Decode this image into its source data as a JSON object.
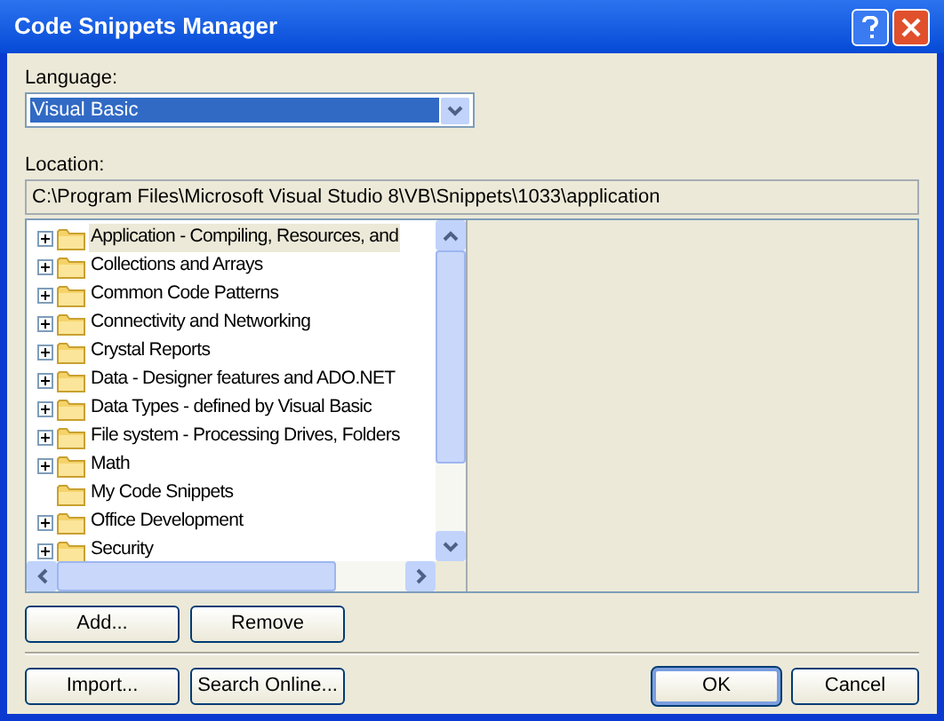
{
  "window": {
    "title": "Code Snippets Manager"
  },
  "language": {
    "label": "Language:",
    "value": "Visual Basic"
  },
  "location": {
    "label": "Location:",
    "value": "C:\\Program Files\\Microsoft Visual Studio 8\\VB\\Snippets\\1033\\application"
  },
  "tree": {
    "items": [
      {
        "label": "Application - Compiling, Resources, and",
        "expandable": true,
        "selected": true
      },
      {
        "label": "Collections and Arrays",
        "expandable": true,
        "selected": false
      },
      {
        "label": "Common Code Patterns",
        "expandable": true,
        "selected": false
      },
      {
        "label": "Connectivity and Networking",
        "expandable": true,
        "selected": false
      },
      {
        "label": "Crystal Reports",
        "expandable": true,
        "selected": false
      },
      {
        "label": "Data - Designer features and ADO.NET",
        "expandable": true,
        "selected": false
      },
      {
        "label": "Data Types - defined by Visual Basic",
        "expandable": true,
        "selected": false
      },
      {
        "label": "File system - Processing Drives, Folders",
        "expandable": true,
        "selected": false
      },
      {
        "label": "Math",
        "expandable": true,
        "selected": false
      },
      {
        "label": "My Code Snippets",
        "expandable": false,
        "selected": false
      },
      {
        "label": "Office Development",
        "expandable": true,
        "selected": false
      },
      {
        "label": "Security",
        "expandable": true,
        "selected": false
      }
    ]
  },
  "buttons_top": [
    "Add...",
    "Remove"
  ],
  "buttons_left": [
    "Import...",
    "Search Online..."
  ],
  "buttons_right": [
    {
      "label": "OK",
      "default": true
    },
    {
      "label": "Cancel",
      "default": false
    }
  ]
}
